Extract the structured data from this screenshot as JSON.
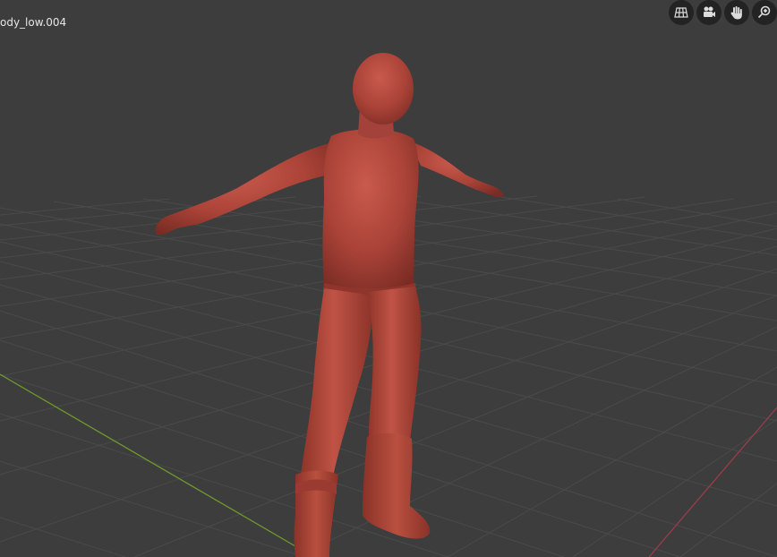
{
  "viewport": {
    "object_name": "ody_low.004",
    "background_color": "#3d3d3d",
    "grid_color": "#4a4a4a",
    "x_axis_color": "#9a3c4a",
    "y_axis_color": "#6f9a2c",
    "model_color": "#b2473c"
  },
  "navigation": {
    "icons": [
      "toggle-view-grid-icon",
      "camera-view-icon",
      "pan-hand-icon",
      "zoom-magnifier-icon"
    ]
  }
}
